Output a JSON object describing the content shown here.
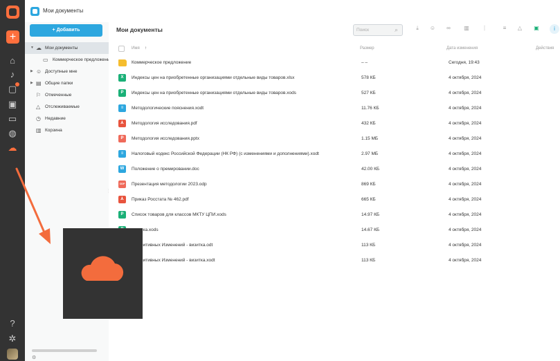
{
  "app": {
    "window_title": "Мои документы"
  },
  "rail": {
    "icons": [
      "logo-icon",
      "plus-icon",
      "home-icon",
      "bell-icon",
      "chat-icon",
      "calendar-icon",
      "video-icon",
      "globe-icon",
      "cloud-icon",
      "help-icon",
      "settings-icon",
      "avatar"
    ]
  },
  "sidebar": {
    "add_label": "+ Добавить",
    "items": [
      {
        "label": "Мои документы"
      },
      {
        "label": "Коммерческое предложение"
      },
      {
        "label": "Доступные мне"
      },
      {
        "label": "Общие папки"
      },
      {
        "label": "Отмеченные"
      },
      {
        "label": "Отслеживаемые"
      },
      {
        "label": "Недавние"
      },
      {
        "label": "Корзина"
      }
    ]
  },
  "main": {
    "title": "Мои документы",
    "search_placeholder": "Поиск",
    "columns": {
      "name": "Имя",
      "size": "Размер",
      "date": "Дата изменения",
      "actions": "Действия"
    },
    "files": [
      {
        "name": "Коммерческое предложение",
        "size": "– –",
        "date": "Сегодня, 19:43",
        "type": "folder"
      },
      {
        "name": "Индексы цен на приобретенные организациями отдельные виды товаров.xlsx",
        "size": "578 КБ",
        "date": "4 октября, 2024",
        "type": "xlsx"
      },
      {
        "name": "Индексы цен на приобретенные организациями отдельные виды товаров.xods",
        "size": "527 КБ",
        "date": "4 октября, 2024",
        "type": "xods"
      },
      {
        "name": "Методологические пояснения.xodt",
        "size": "11.76 КБ",
        "date": "4 октября, 2024",
        "type": "xodt"
      },
      {
        "name": "Методология исследования.pdf",
        "size": "432 КБ",
        "date": "4 октября, 2024",
        "type": "pdf"
      },
      {
        "name": "Методология исследования.pptx",
        "size": "1.15 МБ",
        "date": "4 октября, 2024",
        "type": "pptx"
      },
      {
        "name": "Налоговый кодекс Российской Федерации (НК РФ) (с изменениями и дополнениями).xodt",
        "size": "2.97 МБ",
        "date": "4 октября, 2024",
        "type": "xodt"
      },
      {
        "name": "Положение о премировании.doc",
        "size": "42.00 КБ",
        "date": "4 октября, 2024",
        "type": "doc"
      },
      {
        "name": "Презентация методологии 2023.odp",
        "size": "869 КБ",
        "date": "4 октября, 2024",
        "type": "odp"
      },
      {
        "name": "Приказ Росстата № 462.pdf",
        "size": "665 КБ",
        "date": "4 октября, 2024",
        "type": "pdf"
      },
      {
        "name": "Список товаров для классов МКТУ ЦПИ.xods",
        "size": "14.97 КБ",
        "date": "4 октября, 2024",
        "type": "xods"
      },
      {
        "name": "тистика.xods",
        "size": "14.67 КБ",
        "date": "4 октября, 2024",
        "type": "xods"
      },
      {
        "name": "р Позитивных Изменений - визитка.odt",
        "size": "113 КБ",
        "date": "4 октября, 2024",
        "type": "odt"
      },
      {
        "name": "р Позитивных Изменений - визитка.xodt",
        "size": "113 КБ",
        "date": "4 октября, 2024",
        "type": "xodt"
      }
    ]
  },
  "colors": {
    "accent": "#2da7df",
    "brand_orange": "#ff6f3d",
    "rail_bg": "#333333",
    "folder": "#f5bd2e",
    "xlsx": "#1ab077",
    "xods": "#1ab077",
    "xodt": "#2da7df",
    "pdf": "#e8543e",
    "pptx": "#ef6a5a",
    "doc": "#2da7df",
    "odp": "#ef6a5a",
    "odt": "#2da7df"
  },
  "overlay": {
    "arrow_color": "#f36c3d",
    "cloud_color": "#f36c3d"
  }
}
